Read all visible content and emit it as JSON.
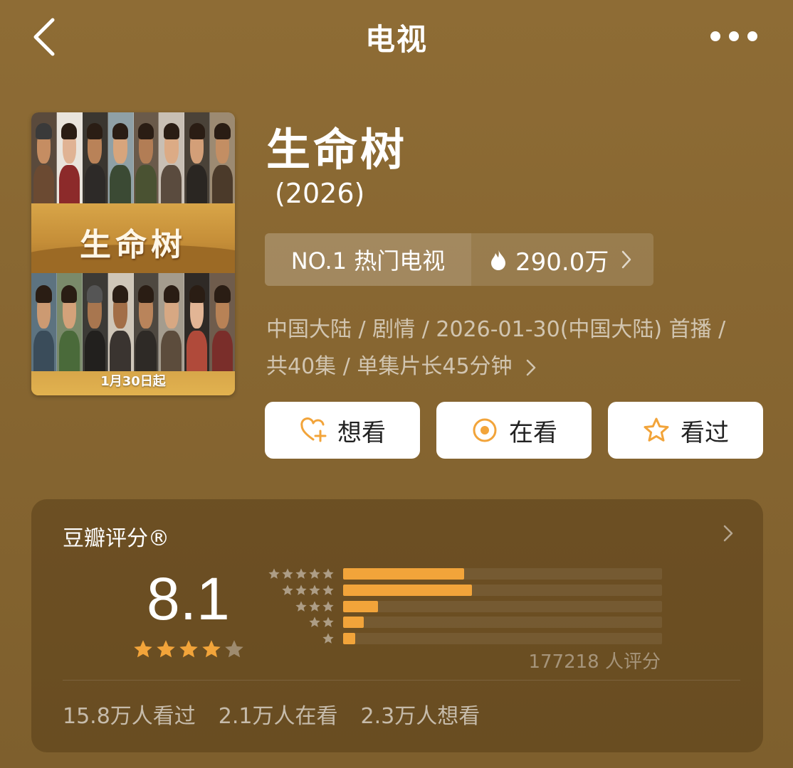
{
  "header": {
    "title": "电视",
    "back_icon": "chevron-left-icon",
    "more_icon": "more-dots-icon"
  },
  "poster": {
    "logo_text": "生命树",
    "date_text": "1月30日起"
  },
  "show": {
    "title": "生命树",
    "year": "(2026)"
  },
  "ranking": {
    "label": "NO.1 热门电视",
    "heat": "290.0万",
    "heat_icon": "flame-icon"
  },
  "meta": {
    "line1": "中国大陆 / 剧情 / 2026-01-30(中国大陆) 首播 /",
    "line2": "共40集 / 单集片长45分钟"
  },
  "actions": {
    "want_label": "想看",
    "watching_label": "在看",
    "watched_label": "看过"
  },
  "rating": {
    "label": "豆瓣评分®",
    "score": "8.1",
    "stars": 4,
    "count": "177218 人评分",
    "distribution": [
      {
        "stars": 5,
        "fraction": 0.38
      },
      {
        "stars": 4,
        "fraction": 0.405
      },
      {
        "stars": 3,
        "fraction": 0.11
      },
      {
        "stars": 2,
        "fraction": 0.064
      },
      {
        "stars": 1,
        "fraction": 0.038
      }
    ],
    "stats": {
      "watched": "15.8万人看过",
      "watching": "2.1万人在看",
      "want": "2.3万人想看"
    }
  },
  "colors": {
    "accent": "#f2a43a",
    "background": "#8a6832"
  }
}
